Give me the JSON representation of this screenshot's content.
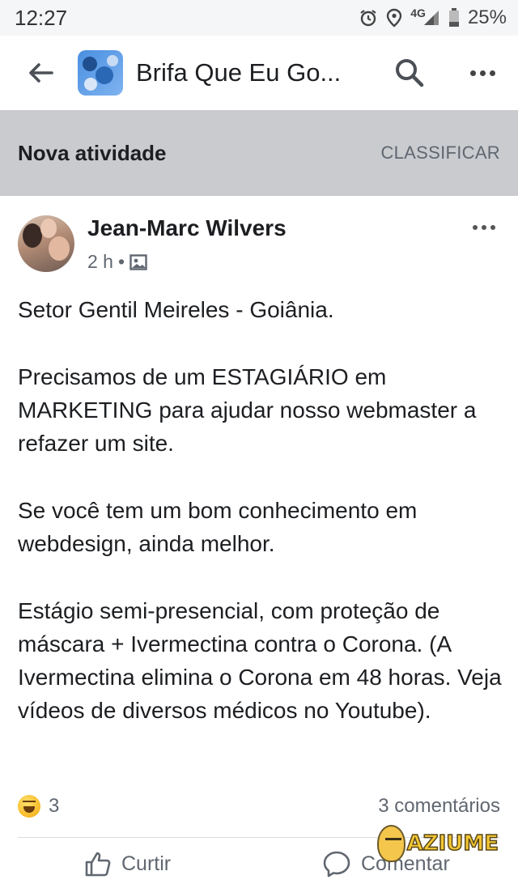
{
  "status_bar": {
    "time": "12:27",
    "network": "4G",
    "battery": "25%",
    "icons": [
      "alarm-icon",
      "location-icon",
      "signal-icon",
      "battery-icon"
    ]
  },
  "app_bar": {
    "title": "Brifa Que Eu Go...",
    "icons": [
      "back-arrow-icon",
      "search-icon",
      "more-icon"
    ]
  },
  "section": {
    "title": "Nova atividade",
    "sort_label": "CLASSIFICAR"
  },
  "post": {
    "author": "Jean-Marc Wilvers",
    "time": "2 h",
    "meta_separator": "•",
    "privacy_icon": "group-photo-icon",
    "paragraphs": [
      "Setor Gentil Meireles - Goiânia.",
      "Precisamos de um ESTAGIÁRIO em MARKETING para ajudar nosso webmaster a refazer um site.",
      "Se você tem um bom conhecimento em webdesign, ainda melhor.",
      "Estágio semi-presencial, com proteção de máscara + Ivermectina contra o Corona. (A Ivermectina elimina o Corona em 48 horas. Veja vídeos de diversos médicos no Youtube)."
    ],
    "reactions": {
      "icon": "haha-icon",
      "count": "3"
    },
    "comments_label": "3 comentários",
    "actions": {
      "like_label": "Curtir",
      "comment_label": "Comentar"
    }
  },
  "watermark": {
    "text": "AZIUME"
  },
  "colors": {
    "section_bg": "#c9cbcf",
    "text_primary": "#1c1e21",
    "text_secondary": "#606770",
    "watermark_yellow": "#f2c634"
  }
}
